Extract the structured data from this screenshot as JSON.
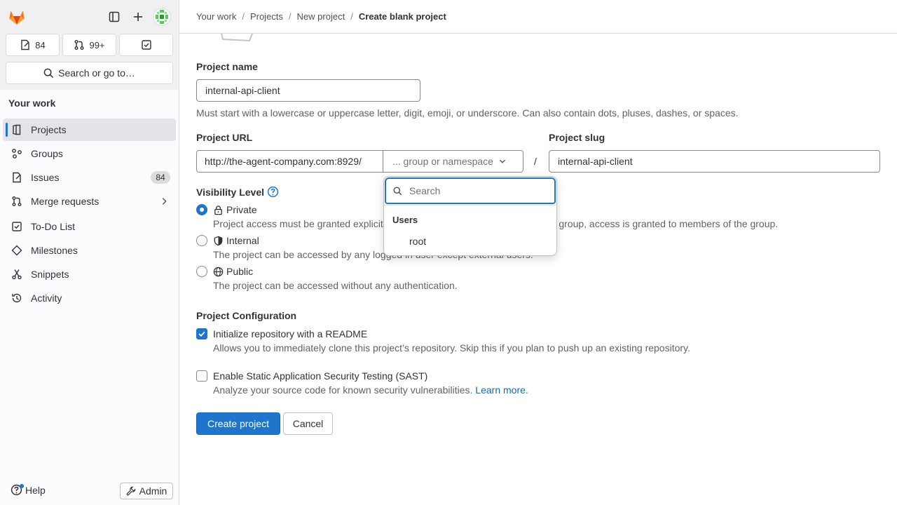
{
  "sidebar": {
    "counts": {
      "issues": "84",
      "merge_requests": "99+"
    },
    "search_label": "Search or go to…",
    "section_title": "Your work",
    "items": [
      {
        "label": "Projects"
      },
      {
        "label": "Groups"
      },
      {
        "label": "Issues",
        "badge": "84"
      },
      {
        "label": "Merge requests"
      },
      {
        "label": "To-Do List"
      },
      {
        "label": "Milestones"
      },
      {
        "label": "Snippets"
      },
      {
        "label": "Activity"
      }
    ],
    "help_label": "Help",
    "admin_label": "Admin"
  },
  "breadcrumbs": [
    "Your work",
    "Projects",
    "New project",
    "Create blank project"
  ],
  "form": {
    "project_name_label": "Project name",
    "project_name_value": "internal-api-client",
    "project_name_hint": "Must start with a lowercase or uppercase letter, digit, emoji, or underscore. Can also contain dots, pluses, dashes, or spaces.",
    "project_url_label": "Project URL",
    "url_prefix": "http://the-agent-company.com:8929/",
    "namespace_placeholder": "... group or namespace",
    "slash": "/",
    "project_slug_label": "Project slug",
    "project_slug_value": "internal-api-client",
    "visibility_label": "Visibility Level",
    "visibility_options": [
      {
        "title": "Private",
        "desc": "Project access must be granted explicitly to each user. If this project is part of a group, access is granted to members of the group.",
        "checked": true
      },
      {
        "title": "Internal",
        "desc": "The project can be accessed by any logged in user except external users.",
        "checked": false
      },
      {
        "title": "Public",
        "desc": "The project can be accessed without any authentication.",
        "checked": false
      }
    ],
    "config_label": "Project Configuration",
    "readme_label": "Initialize repository with a README",
    "readme_desc": "Allows you to immediately clone this project’s repository. Skip this if you plan to push up an existing repository.",
    "sast_label": "Enable Static Application Security Testing (SAST)",
    "sast_desc": "Analyze your source code for known security vulnerabilities.",
    "sast_link": "Learn more.",
    "create_label": "Create project",
    "cancel_label": "Cancel"
  },
  "dropdown": {
    "search_placeholder": "Search",
    "group_label": "Users",
    "items": [
      "root"
    ]
  },
  "colors": {
    "accent": "#1f75cb",
    "link": "#1068bf"
  }
}
